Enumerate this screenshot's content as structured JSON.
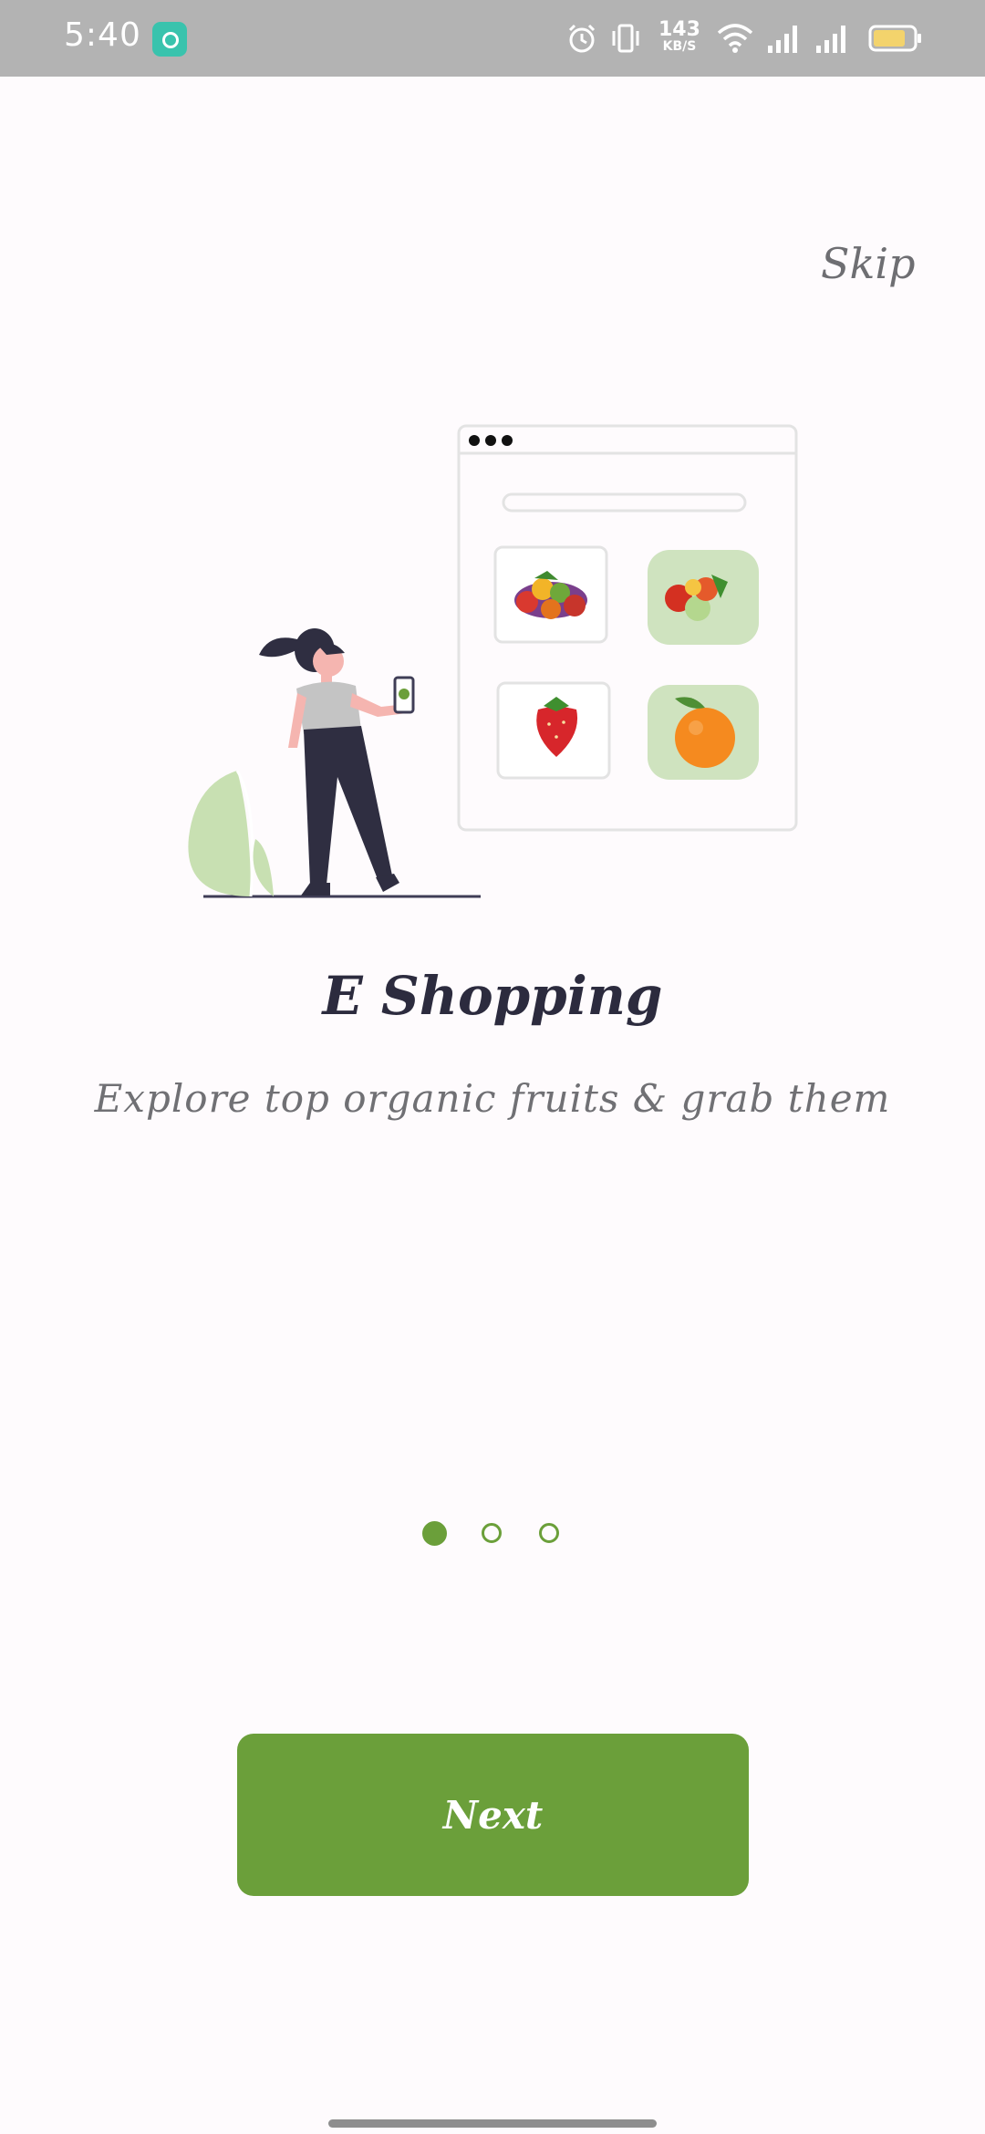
{
  "status_bar": {
    "time": "5:40",
    "net_speed_value": "143",
    "net_speed_unit": "KB/S",
    "icons": [
      "app-notification-icon",
      "alarm-icon",
      "vibrate-icon",
      "wifi-icon",
      "signal-icon",
      "signal-icon-2",
      "battery-icon"
    ]
  },
  "onboarding": {
    "skip_label": "Skip",
    "title": "E Shopping",
    "subtitle": "Explore  top organic fruits & grab them",
    "page_indicator": {
      "total": 3,
      "current": 1
    },
    "next_label": "Next"
  },
  "colors": {
    "accent": "#6b9f3a",
    "background": "#fefbfd",
    "status_bar": "#b3b3b3",
    "title": "#2c2b3e",
    "subtitle": "#707074"
  }
}
